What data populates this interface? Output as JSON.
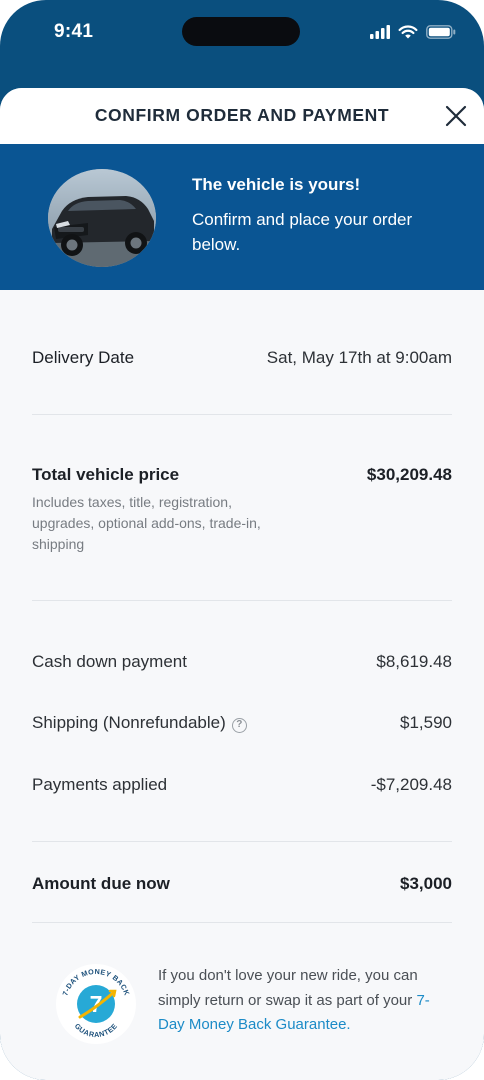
{
  "status_bar": {
    "time": "9:41"
  },
  "header": {
    "title": "CONFIRM ORDER AND PAYMENT"
  },
  "banner": {
    "title": "The vehicle is yours!",
    "text": "Confirm and place your order below."
  },
  "delivery": {
    "label": "Delivery Date",
    "value": "Sat, May 17th at 9:00am"
  },
  "total": {
    "label": "Total vehicle price",
    "value": "$30,209.48",
    "note": "Includes taxes, title, registration, upgrades, optional add-ons, trade-in, shipping"
  },
  "line_items": [
    {
      "label": "Cash down payment",
      "value": "$8,619.48"
    },
    {
      "label": "Shipping (Nonrefundable)",
      "value": "$1,590"
    },
    {
      "label": "Payments applied",
      "value": "-$7,209.48"
    }
  ],
  "amount_due": {
    "label": "Amount due now",
    "value": "$3,000"
  },
  "guarantee": {
    "badge_top": "7-DAY MONEY BACK",
    "badge_number": "7",
    "badge_bottom": "GUARANTEE",
    "text": "If you don't love your new ride, you can simply return or swap it as part of your ",
    "link": "7-Day Money Back Guarantee."
  },
  "colors": {
    "banner": "#0a5593",
    "phone": "#0a4f7e",
    "link": "#1c8bc7",
    "badge": "#27a9d6"
  }
}
